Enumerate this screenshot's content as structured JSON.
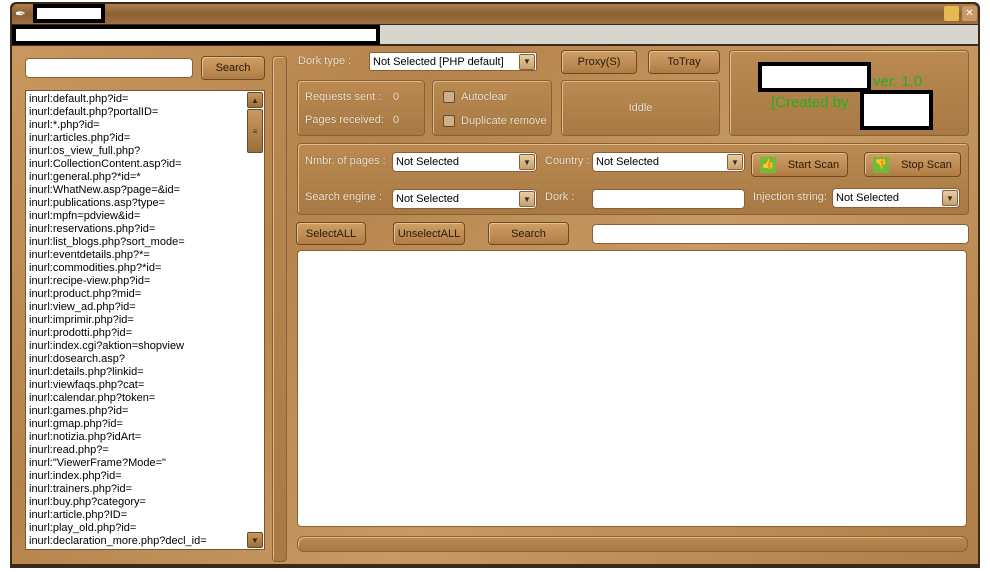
{
  "window": {
    "min_icon": "minimize-icon",
    "close_icon": "close-icon",
    "app_icon": "feather-icon"
  },
  "left": {
    "search_placeholder": "",
    "search_label": "Search",
    "dorks": [
      "inurl:default.php?id=",
      "inurl:default.php?portalID=",
      "inurl:*.php?id=",
      "inurl:articles.php?id=",
      "inurl:os_view_full.php?",
      "inurl:CollectionContent.asp?id=",
      "inurl:general.php?*id=*",
      "inurl:WhatNew.asp?page=&id=",
      "inurl:publications.asp?type=",
      "inurl:mpfn=pdview&id=",
      "inurl:reservations.php?id=",
      "inurl:list_blogs.php?sort_mode=",
      "inurl:eventdetails.php?*=",
      "inurl:commodities.php?*id=",
      "inurl:recipe-view.php?id=",
      "inurl:product.php?mid=",
      "inurl:view_ad.php?id=",
      "inurl:imprimir.php?id=",
      "inurl:prodotti.php?id=",
      "inurl:index.cgi?aktion=shopview",
      "inurl:dosearch.asp?",
      "inurl:details.php?linkid=",
      "inurl:viewfaqs.php?cat=",
      "inurl:calendar.php?token=",
      "inurl:games.php?id=",
      "inurl:gmap.php?id=",
      "inurl:notizia.php?idArt=",
      "inurl:read.php?=",
      "inurl:\"ViewerFrame?Mode=\"",
      "inurl:index.php?id=",
      "inurl:trainers.php?id=",
      "inurl:buy.php?category=",
      "inurl:article.php?ID=",
      "inurl:play_old.php?id=",
      "inurl:declaration_more.php?decl_id="
    ]
  },
  "top": {
    "dork_type_label": "Dork type :",
    "dork_type_value": "Not Selected [PHP default]",
    "proxy_label": "Proxy(S)",
    "totray_label": "ToTray",
    "requests_label": "Requests sent :",
    "requests_value": "0",
    "pages_label": "Pages received:",
    "pages_value": "0",
    "autoclear_label": "Autoclear",
    "autoclear_checked": false,
    "dup_label": "Duplicate remove",
    "dup_checked": false,
    "status": "Iddle",
    "version": "ver. 1.0",
    "created_by": "[Created by",
    "brand_color": "#22b022"
  },
  "options": {
    "pages_label": "Nmbr. of pages :",
    "pages_value": "Not Selected",
    "country_label": "Country :",
    "country_value": "Not Selected",
    "start_label": "Start Scan",
    "stop_label": "Stop Scan",
    "engine_label": "Search engine :",
    "engine_value": "Not Selected",
    "dork_label": "Dork :",
    "dork_value": "",
    "injection_label": "Injection string:",
    "injection_value": "Not Selected"
  },
  "actions": {
    "select_all": "SelectALL",
    "unselect_all": "UnselectALL",
    "search": "Search",
    "filter_value": ""
  },
  "results": {
    "text": ""
  }
}
